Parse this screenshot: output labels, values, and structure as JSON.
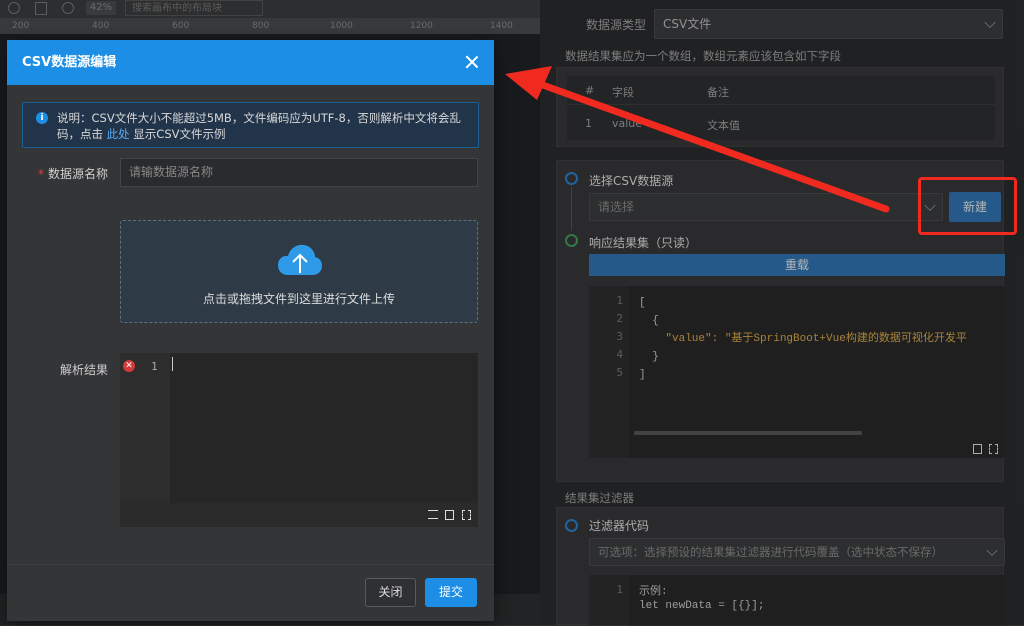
{
  "toolbar": {
    "zoom": "42%",
    "search_placeholder": "搜索画布中的布局块",
    "ruler_ticks": [
      "200",
      "400",
      "600",
      "800",
      "1000",
      "1200",
      "1400"
    ]
  },
  "right_panel": {
    "datasource_type_label": "数据源类型",
    "datasource_type_value": "CSV文件",
    "result_hint": "数据结果集应为一个数组，数组元素应该包含如下字段",
    "fields_table": {
      "headers": [
        "#",
        "字段",
        "备注"
      ],
      "rows": [
        [
          "1",
          "value",
          "文本值"
        ]
      ]
    },
    "select_csv_label": "选择CSV数据源",
    "select_placeholder": "请选择",
    "new_button": "新建",
    "response_label": "响应结果集（只读）",
    "reload_button": "重载",
    "response_code": {
      "line_numbers": [
        "1",
        "2",
        "3",
        "4",
        "5"
      ],
      "lines": [
        "[",
        "  {",
        "    \"value\": \"基于SpringBoot+Vue构建的数据可视化开发平",
        "  }",
        "]"
      ]
    },
    "filter_section_label": "结果集过滤器",
    "filter_code_label": "过滤器代码",
    "filter_select_placeholder": "可选项：选择预设的结果集过滤器进行代码覆盖（选中状态不保存）",
    "filter_code": {
      "line_numbers": [
        "1"
      ],
      "lines": [
        "示例:",
        "let newData = [{}];"
      ]
    }
  },
  "modal": {
    "title": "CSV数据源编辑",
    "alert": {
      "text_before": "说明：CSV文件大小不能超过5MB，文件编码应为UTF-8，否则解析中文将会乱码，点击 ",
      "link": "此处",
      "text_after": " 显示CSV文件示例"
    },
    "name_label": "数据源名称",
    "required_mark": "*",
    "name_placeholder": "请输数据源名称",
    "upload_text": "点击或拖拽文件到这里进行文件上传",
    "parse_label": "解析结果",
    "editor_line": "1",
    "close_button": "关闭",
    "submit_button": "提交"
  },
  "colors": {
    "primary": "#1c8ee5",
    "annotation_red": "#f02a1e",
    "error": "#d13a3a"
  }
}
